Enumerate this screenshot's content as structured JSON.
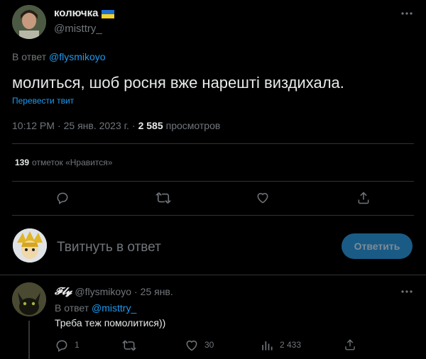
{
  "tweet": {
    "author": {
      "name": "колючка",
      "handle": "@misttry_",
      "flag": "ukraine-flag-icon"
    },
    "reply_to_prefix": "В ответ",
    "reply_to_handle": "@flysmikoyo",
    "text": "молиться, шоб росня вже нарешті виздихала.",
    "translate": "Перевести твит",
    "time": "10:12 PM",
    "dot": "·",
    "date": "25 янв. 2023 г.",
    "views_count": "2 585",
    "views_label": "просмотров",
    "likes_count": "139",
    "likes_label": "отметок «Нравится»"
  },
  "compose": {
    "placeholder": "Твитнуть в ответ",
    "button": "Ответить"
  },
  "reply": {
    "author": {
      "name": "𝓕𝓵𝔂",
      "handle": "@flysmikoyo",
      "dot": "·",
      "date": "25 янв."
    },
    "reply_to_prefix": "В ответ",
    "reply_to_handle": "@misttry_",
    "text": "Треба теж помолитися))",
    "stats": {
      "replies": "1",
      "retweets": "",
      "likes": "30",
      "views": "2 433"
    }
  },
  "colors": {
    "accent": "#1d9bf0",
    "muted": "#71767b",
    "border": "#2f3336",
    "background": "#000000"
  }
}
